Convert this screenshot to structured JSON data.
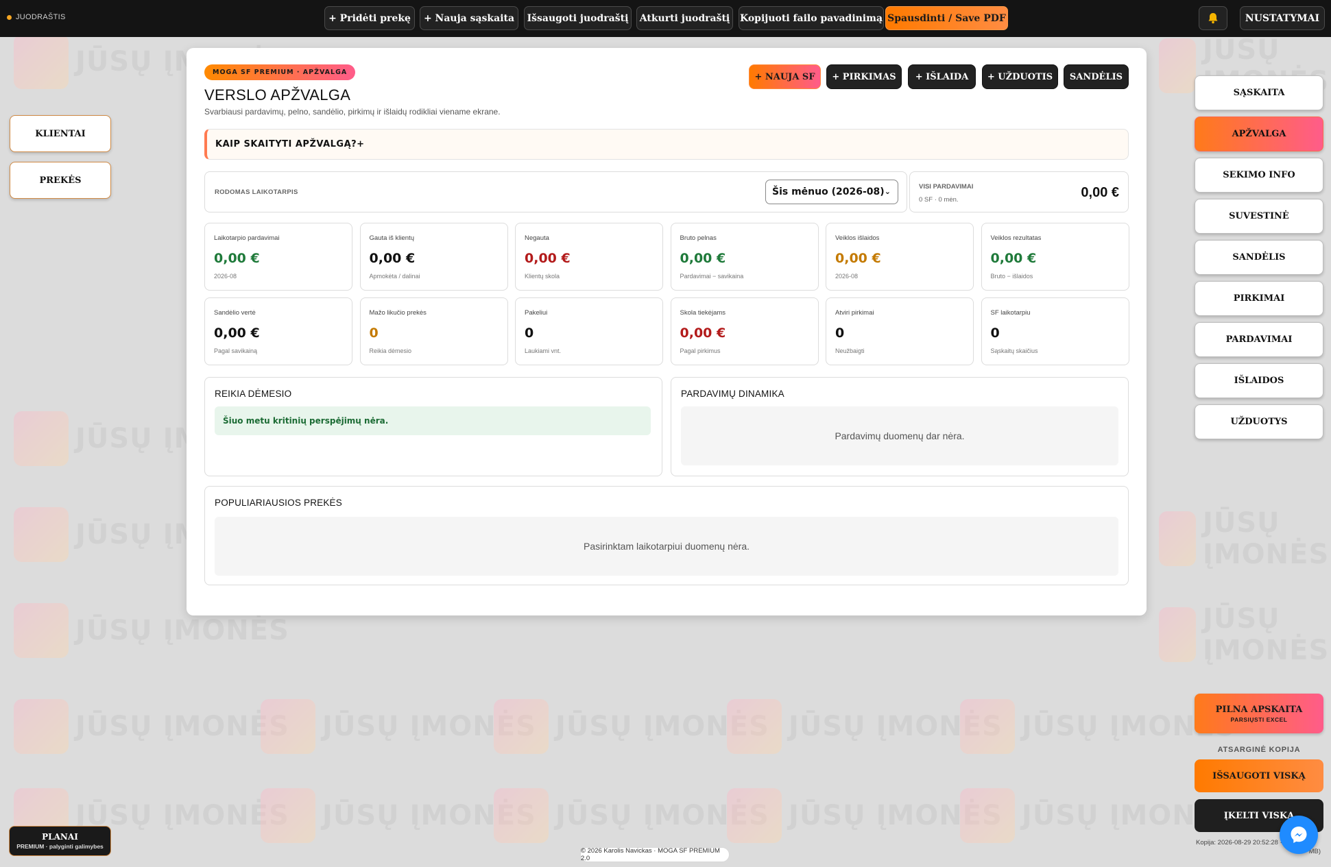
{
  "topbar": {
    "brand": "JUODRAŠTIS",
    "buttons": [
      {
        "label": "+ Pridėti prekę"
      },
      {
        "label": "+ Nauja sąskaita"
      },
      {
        "label": "Išsaugoti juodraštį"
      },
      {
        "label": "Atkurti juodraštį"
      },
      {
        "label": "Kopijuoti failo pavadinimą"
      },
      {
        "label": "Spausdinti / Save PDF"
      }
    ],
    "settings": "NUSTATYMAI"
  },
  "left_nav": [
    "KLIENTAI",
    "PREKĖS"
  ],
  "right_nav": [
    {
      "label": "SĄSKAITA",
      "active": false
    },
    {
      "label": "APŽVALGA",
      "active": true
    },
    {
      "label": "SEKIMO INFO",
      "active": false
    },
    {
      "label": "SUVESTINĖ",
      "active": false
    },
    {
      "label": "SANDĖLIS",
      "active": false
    },
    {
      "label": "PIRKIMAI",
      "active": false
    },
    {
      "label": "PARDAVIMAI",
      "active": false
    },
    {
      "label": "IŠLAIDOS",
      "active": false
    },
    {
      "label": "UŽDUOTYS",
      "active": false
    }
  ],
  "card": {
    "badge": "MOGA SF PREMIUM · APŽVALGA",
    "title": "VERSLO APŽVALGA",
    "subtitle": "Svarbiausi pardavimų, pelno, sandėlio, pirkimų ir išlaidų rodikliai viename ekrane.",
    "quick_actions": [
      "+ NAUJA SF",
      "+ PIRKIMAS",
      "+ IŠLAIDA",
      "+ UŽDUOTIS",
      "SANDĖLIS"
    ],
    "help": "KAIP SKAITYTI APŽVALGĄ?+",
    "period_label": "RODOMAS LAIKOTARPIS",
    "period_value": "Šis mėnuo (2026-08)",
    "all_sales": {
      "label": "VISI PARDAVIMAI",
      "sub": "0 SF · 0 mėn.",
      "value": "0,00 €"
    },
    "metrics": [
      {
        "label": "Laikotarpio pardavimai",
        "value": "0,00 €",
        "sub": "2026-08",
        "color": "green"
      },
      {
        "label": "Gauta iš klientų",
        "value": "0,00 €",
        "sub": "Apmokėta / dalinai",
        "color": "black"
      },
      {
        "label": "Negauta",
        "value": "0,00 €",
        "sub": "Klientų skola",
        "color": "red"
      },
      {
        "label": "Bruto pelnas",
        "value": "0,00 €",
        "sub": "Pardavimai − savikaina",
        "color": "green"
      },
      {
        "label": "Veiklos išlaidos",
        "value": "0,00 €",
        "sub": "2026-08",
        "color": "amber"
      },
      {
        "label": "Veiklos rezultatas",
        "value": "0,00 €",
        "sub": "Bruto − išlaidos",
        "color": "green"
      },
      {
        "label": "Sandėlio vertė",
        "value": "0,00 €",
        "sub": "Pagal savikainą",
        "color": "black"
      },
      {
        "label": "Mažo likučio prekės",
        "value": "0",
        "sub": "Reikia dėmesio",
        "color": "amber"
      },
      {
        "label": "Pakeliui",
        "value": "0",
        "sub": "Laukiami vnt.",
        "color": "black"
      },
      {
        "label": "Skola tiekėjams",
        "value": "0,00 €",
        "sub": "Pagal pirkimus",
        "color": "red"
      },
      {
        "label": "Atviri pirkimai",
        "value": "0",
        "sub": "Neužbaigti",
        "color": "black"
      },
      {
        "label": "SF laikotarpiu",
        "value": "0",
        "sub": "Sąskaitų skaičius",
        "color": "black"
      }
    ],
    "attention": {
      "title": "REIKIA DĖMESIO",
      "message": "Šiuo metu kritinių perspėjimų nėra."
    },
    "dynamics": {
      "title": "PARDAVIMŲ DINAMIKA",
      "empty": "Pardavimų duomenų dar nėra."
    },
    "popular": {
      "title": "POPULIARIAUSIOS PREKĖS",
      "empty": "Pasirinktam laikotarpiui duomenų nėra."
    }
  },
  "full_accounting": {
    "title": "PILNA APSKAITA",
    "sub": "PARSIŲSTI EXCEL"
  },
  "backup": {
    "label": "ATSARGINĖ KOPIJA",
    "save": "IŠSAUGOTI VISKĄ",
    "load": "ĮKELTI VISKĄ",
    "info_line1": "Kopija: 2026-08-29 20:52:28 · 0.0",
    "info_line2": "MB)"
  },
  "plans": {
    "title": "PLANAI",
    "sub": "PREMIUM · palyginti galimybes"
  },
  "footer": "© 2026 Karolis Navickas · MOGA SF PREMIUM 2.0",
  "watermark": {
    "text": "JŪSŲ ĮMONĖS"
  },
  "colors": {
    "accent_orange": "#ff7a00",
    "accent_pink": "#ff5c8a",
    "green": "#1f7a3a",
    "red": "#b31b1b",
    "amber": "#c47a00"
  }
}
